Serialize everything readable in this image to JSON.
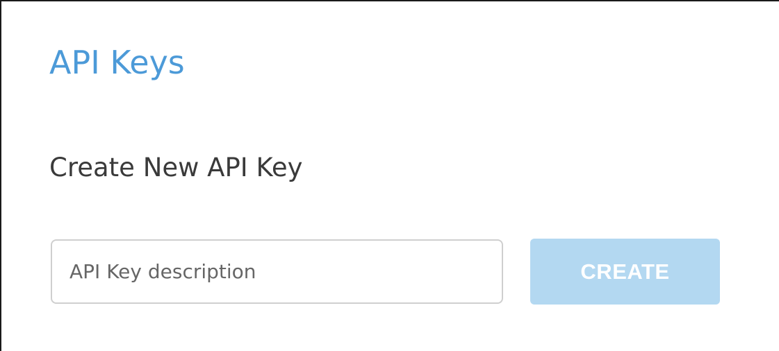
{
  "page": {
    "title": "API Keys"
  },
  "create_section": {
    "heading": "Create New API Key",
    "description_input": {
      "value": "",
      "placeholder": "API Key description"
    },
    "create_button": {
      "label": "CREATE",
      "state": "disabled"
    }
  },
  "colors": {
    "title": "#4c9ad8",
    "heading": "#3a3a3a",
    "button_disabled_bg": "#b3d8f1",
    "button_text": "#ffffff",
    "input_border": "#cfcfcf"
  }
}
